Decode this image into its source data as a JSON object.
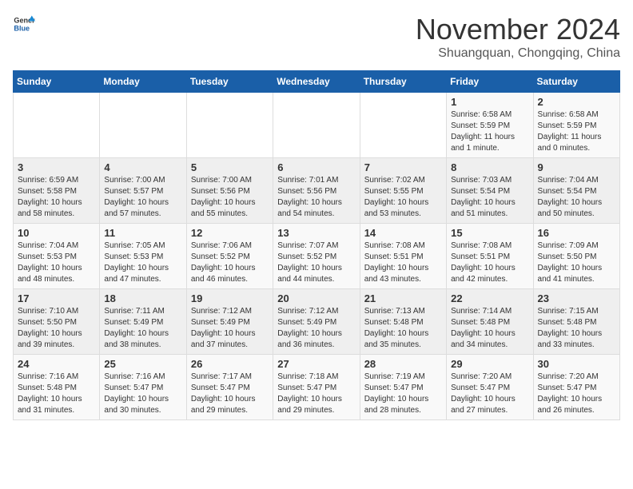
{
  "header": {
    "logo_general": "General",
    "logo_blue": "Blue",
    "month": "November 2024",
    "location": "Shuangquan, Chongqing, China"
  },
  "days_of_week": [
    "Sunday",
    "Monday",
    "Tuesday",
    "Wednesday",
    "Thursday",
    "Friday",
    "Saturday"
  ],
  "weeks": [
    [
      {
        "day": "",
        "info": ""
      },
      {
        "day": "",
        "info": ""
      },
      {
        "day": "",
        "info": ""
      },
      {
        "day": "",
        "info": ""
      },
      {
        "day": "",
        "info": ""
      },
      {
        "day": "1",
        "info": "Sunrise: 6:58 AM\nSunset: 5:59 PM\nDaylight: 11 hours\nand 1 minute."
      },
      {
        "day": "2",
        "info": "Sunrise: 6:58 AM\nSunset: 5:59 PM\nDaylight: 11 hours\nand 0 minutes."
      }
    ],
    [
      {
        "day": "3",
        "info": "Sunrise: 6:59 AM\nSunset: 5:58 PM\nDaylight: 10 hours\nand 58 minutes."
      },
      {
        "day": "4",
        "info": "Sunrise: 7:00 AM\nSunset: 5:57 PM\nDaylight: 10 hours\nand 57 minutes."
      },
      {
        "day": "5",
        "info": "Sunrise: 7:00 AM\nSunset: 5:56 PM\nDaylight: 10 hours\nand 55 minutes."
      },
      {
        "day": "6",
        "info": "Sunrise: 7:01 AM\nSunset: 5:56 PM\nDaylight: 10 hours\nand 54 minutes."
      },
      {
        "day": "7",
        "info": "Sunrise: 7:02 AM\nSunset: 5:55 PM\nDaylight: 10 hours\nand 53 minutes."
      },
      {
        "day": "8",
        "info": "Sunrise: 7:03 AM\nSunset: 5:54 PM\nDaylight: 10 hours\nand 51 minutes."
      },
      {
        "day": "9",
        "info": "Sunrise: 7:04 AM\nSunset: 5:54 PM\nDaylight: 10 hours\nand 50 minutes."
      }
    ],
    [
      {
        "day": "10",
        "info": "Sunrise: 7:04 AM\nSunset: 5:53 PM\nDaylight: 10 hours\nand 48 minutes."
      },
      {
        "day": "11",
        "info": "Sunrise: 7:05 AM\nSunset: 5:53 PM\nDaylight: 10 hours\nand 47 minutes."
      },
      {
        "day": "12",
        "info": "Sunrise: 7:06 AM\nSunset: 5:52 PM\nDaylight: 10 hours\nand 46 minutes."
      },
      {
        "day": "13",
        "info": "Sunrise: 7:07 AM\nSunset: 5:52 PM\nDaylight: 10 hours\nand 44 minutes."
      },
      {
        "day": "14",
        "info": "Sunrise: 7:08 AM\nSunset: 5:51 PM\nDaylight: 10 hours\nand 43 minutes."
      },
      {
        "day": "15",
        "info": "Sunrise: 7:08 AM\nSunset: 5:51 PM\nDaylight: 10 hours\nand 42 minutes."
      },
      {
        "day": "16",
        "info": "Sunrise: 7:09 AM\nSunset: 5:50 PM\nDaylight: 10 hours\nand 41 minutes."
      }
    ],
    [
      {
        "day": "17",
        "info": "Sunrise: 7:10 AM\nSunset: 5:50 PM\nDaylight: 10 hours\nand 39 minutes."
      },
      {
        "day": "18",
        "info": "Sunrise: 7:11 AM\nSunset: 5:49 PM\nDaylight: 10 hours\nand 38 minutes."
      },
      {
        "day": "19",
        "info": "Sunrise: 7:12 AM\nSunset: 5:49 PM\nDaylight: 10 hours\nand 37 minutes."
      },
      {
        "day": "20",
        "info": "Sunrise: 7:12 AM\nSunset: 5:49 PM\nDaylight: 10 hours\nand 36 minutes."
      },
      {
        "day": "21",
        "info": "Sunrise: 7:13 AM\nSunset: 5:48 PM\nDaylight: 10 hours\nand 35 minutes."
      },
      {
        "day": "22",
        "info": "Sunrise: 7:14 AM\nSunset: 5:48 PM\nDaylight: 10 hours\nand 34 minutes."
      },
      {
        "day": "23",
        "info": "Sunrise: 7:15 AM\nSunset: 5:48 PM\nDaylight: 10 hours\nand 33 minutes."
      }
    ],
    [
      {
        "day": "24",
        "info": "Sunrise: 7:16 AM\nSunset: 5:48 PM\nDaylight: 10 hours\nand 31 minutes."
      },
      {
        "day": "25",
        "info": "Sunrise: 7:16 AM\nSunset: 5:47 PM\nDaylight: 10 hours\nand 30 minutes."
      },
      {
        "day": "26",
        "info": "Sunrise: 7:17 AM\nSunset: 5:47 PM\nDaylight: 10 hours\nand 29 minutes."
      },
      {
        "day": "27",
        "info": "Sunrise: 7:18 AM\nSunset: 5:47 PM\nDaylight: 10 hours\nand 29 minutes."
      },
      {
        "day": "28",
        "info": "Sunrise: 7:19 AM\nSunset: 5:47 PM\nDaylight: 10 hours\nand 28 minutes."
      },
      {
        "day": "29",
        "info": "Sunrise: 7:20 AM\nSunset: 5:47 PM\nDaylight: 10 hours\nand 27 minutes."
      },
      {
        "day": "30",
        "info": "Sunrise: 7:20 AM\nSunset: 5:47 PM\nDaylight: 10 hours\nand 26 minutes."
      }
    ]
  ]
}
